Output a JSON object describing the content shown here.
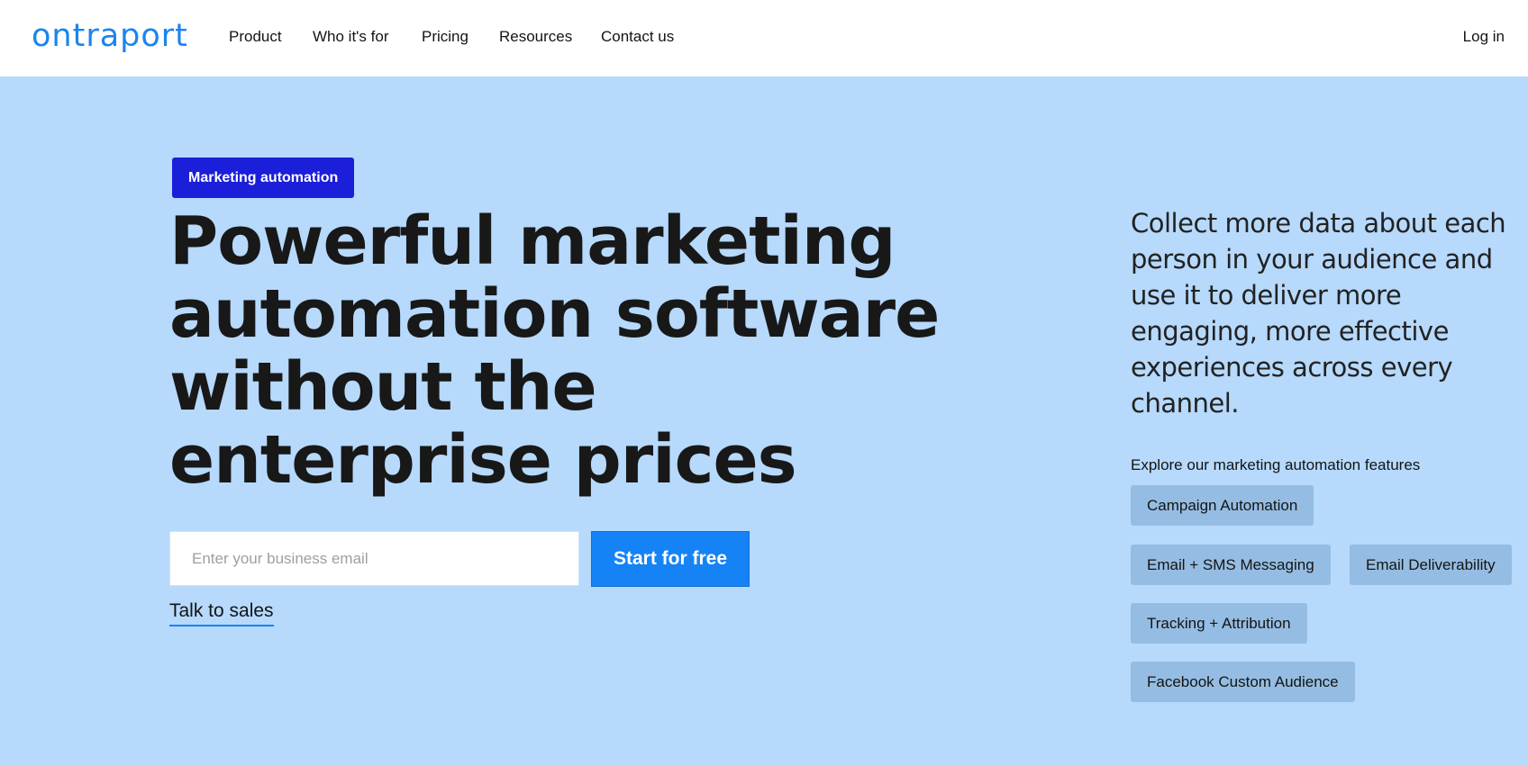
{
  "header": {
    "logo": "ontraport",
    "nav": [
      "Product",
      "Who it's for",
      "Pricing",
      "Resources",
      "Contact us"
    ],
    "login": "Log in"
  },
  "hero": {
    "badge": "Marketing automation",
    "headline": "Powerful marketing automation software without the enterprise prices",
    "email_placeholder": "Enter your business email",
    "start_button": "Start for free",
    "talk_link": "Talk to sales"
  },
  "aside": {
    "description": "Collect more data about each person in your audience and use it to deliver more engaging, more effective experiences across every channel.",
    "explore_label": "Explore our marketing automation features",
    "features": [
      "Campaign Automation",
      "Email + SMS Messaging",
      "Email Deliverability",
      "Tracking + Attribution",
      "Facebook Custom Audience"
    ]
  },
  "colors": {
    "brand": "#1a84f0",
    "hero_background": "#b6d9fc",
    "badge": "#1b1fd9",
    "button": "#1583f5",
    "chip": "#95bde3"
  }
}
